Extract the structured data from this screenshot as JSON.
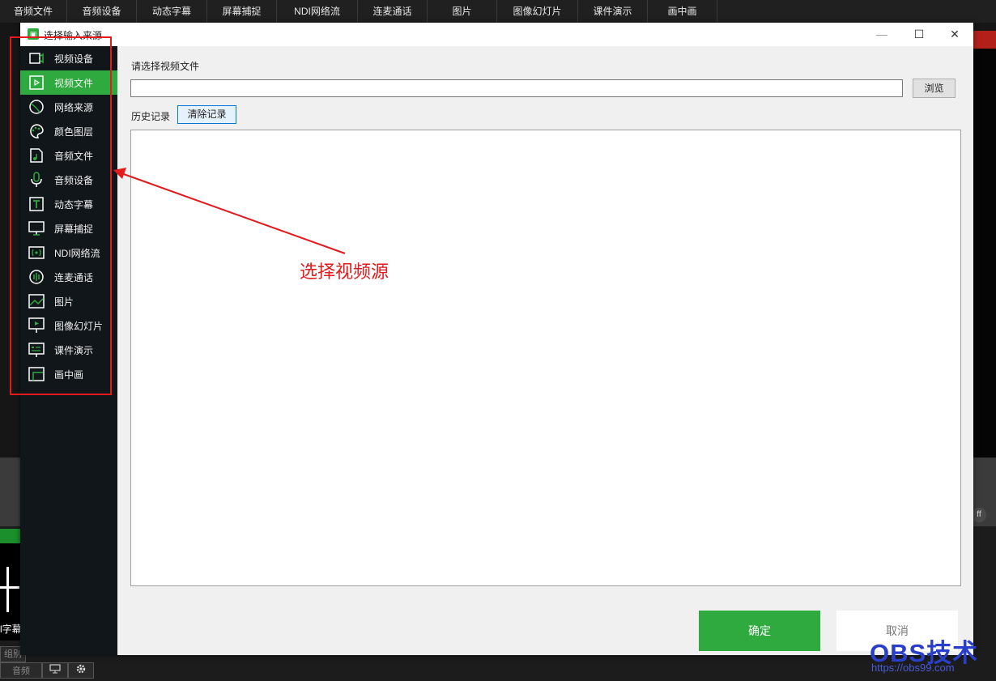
{
  "app": {
    "tabs": [
      "音频文件",
      "音频设备",
      "动态字幕",
      "屏幕捕捉",
      "NDI网络流",
      "连麦通话",
      "图片",
      "图像幻灯片",
      "课件演示",
      "画中画"
    ],
    "preview_caption": "l字幕",
    "control_label": "组别",
    "footer_audio": "音频",
    "right_badge": "ff"
  },
  "dialog": {
    "title": "选择输入来源",
    "minimize_glyph": "—",
    "maximize_glyph": "☐",
    "close_glyph": "✕",
    "sidebar_items": [
      {
        "label": "视频设备",
        "icon": "video-camera-icon"
      },
      {
        "label": "视频文件",
        "icon": "video-file-icon",
        "active": true
      },
      {
        "label": "网络来源",
        "icon": "globe-icon"
      },
      {
        "label": "颜色图层",
        "icon": "palette-icon"
      },
      {
        "label": "音频文件",
        "icon": "audio-file-icon"
      },
      {
        "label": "音频设备",
        "icon": "microphone-icon"
      },
      {
        "label": "动态字幕",
        "icon": "text-icon"
      },
      {
        "label": "屏幕捕捉",
        "icon": "monitor-icon"
      },
      {
        "label": "NDI网络流",
        "icon": "ndi-stream-icon"
      },
      {
        "label": "连麦通话",
        "icon": "call-wave-icon"
      },
      {
        "label": "图片",
        "icon": "image-icon"
      },
      {
        "label": "图像幻灯片",
        "icon": "slideshow-icon"
      },
      {
        "label": "课件演示",
        "icon": "presentation-icon"
      },
      {
        "label": "画中画",
        "icon": "pip-icon"
      }
    ],
    "select_label": "请选择视频文件",
    "path_value": "",
    "browse_label": "浏览",
    "history_label": "历史记录",
    "clear_label": "清除记录",
    "ok_label": "确定",
    "cancel_label": "取消"
  },
  "annotation": {
    "text": "选择视频源",
    "color": "#e3191c"
  },
  "watermark": {
    "brand": "OBS技术",
    "url": "https://obs99.com"
  },
  "colors": {
    "accent_green": "#2eaa3f",
    "sidebar_bg": "#11161a",
    "watermark_blue": "#2a3fc9"
  }
}
